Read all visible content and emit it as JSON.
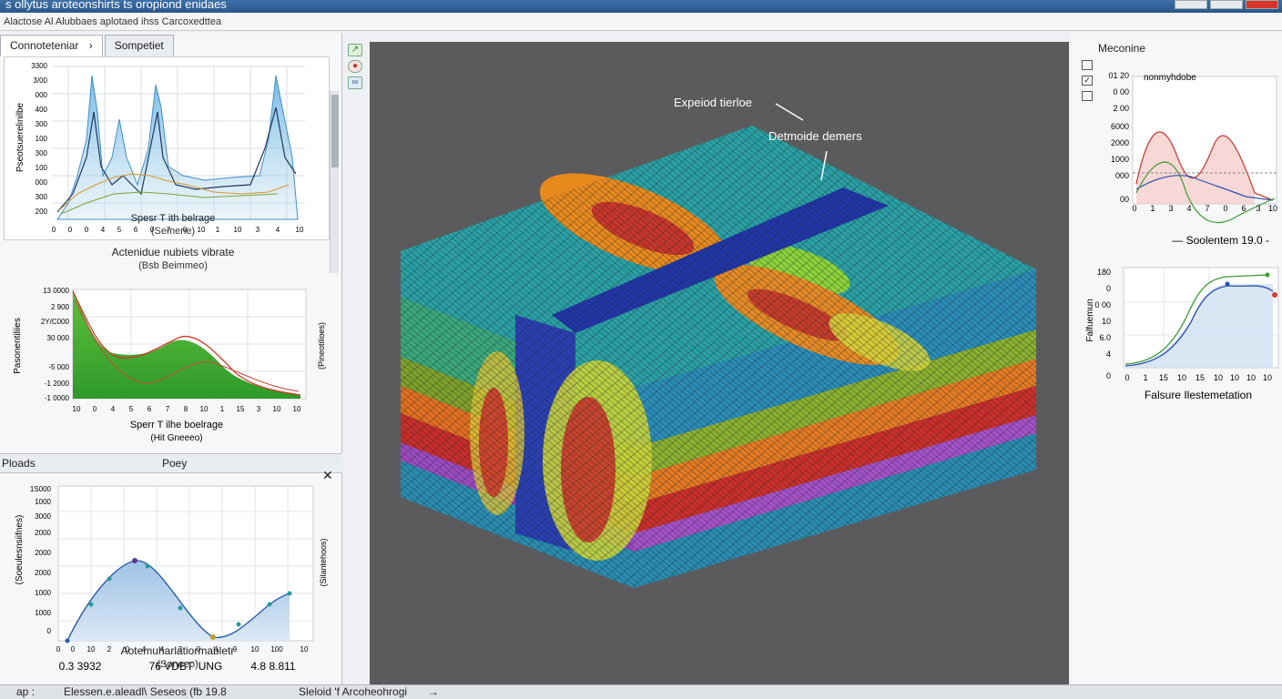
{
  "window": {
    "title": "s ollytus aroteonshirts ts oropiond enidaes",
    "menu_text": "Alactose Al Alubbaes aplotaed ihss Carcoxedttea"
  },
  "left_panel": {
    "tabs": [
      {
        "label": "Connoteteniar",
        "chevron": "›"
      },
      {
        "label": "Sompetiet"
      }
    ],
    "section_header": {
      "left": "Ploads",
      "center": "Poey",
      "close": "✕"
    }
  },
  "charts": {
    "chart1": {
      "ylabel": "Pseotsuerelinilbe",
      "yticks": [
        "3300",
        "3/00",
        "000",
        "400",
        "300",
        "100",
        "300",
        "100",
        "000",
        "300",
        "200"
      ],
      "xticks": [
        "0",
        "0",
        "0",
        "4",
        "5",
        "6",
        "0",
        "7",
        "0",
        "10",
        "1",
        "10",
        "3",
        "4",
        "10"
      ],
      "xlabel": "Spesr T ith belrage",
      "sub": "(Semene)",
      "caption_below": "Actenidue nubiets vibrate",
      "caption_below_sub": "(Bsb Beimmeo)"
    },
    "chart2": {
      "ylabel": "Pasonentiliies",
      "yticks": [
        "13 0000",
        "2 900",
        "2Y/C000",
        "30 000",
        "-5 000",
        "-1 2000",
        "-1 0000"
      ],
      "xticks": [
        "10",
        "0",
        "4",
        "5",
        "6",
        "7",
        "8",
        "10",
        "1",
        "15",
        "3",
        "10",
        "10"
      ],
      "right_label": "(Pineotilioes)",
      "xlabel": "Sperr T ilhe boelrage",
      "sub": "(Hit Gneeeo)"
    },
    "chart3": {
      "ylabel": "(Soeulesnsiifnes)",
      "yticks": [
        "1S000",
        "1000",
        "3000",
        "2000",
        "2000",
        "2000",
        "1000",
        "1000",
        "0"
      ],
      "xticks": [
        "0",
        "0",
        "10",
        "2",
        "0",
        "4",
        "4",
        "3",
        "0",
        "1",
        "9",
        "10",
        "100",
        "10"
      ],
      "right_label": "(Silantehoos)",
      "xlabel_left": "0.3 3932",
      "xlabel_mid": "76 VDBT 'UNG",
      "xlabel_right": "4.8 8.811",
      "caption": "Aotemuharlatiormabletr",
      "caption_sub": "(Soneeo)"
    },
    "chart4": {
      "title": "Meconine",
      "subtitle": "nonmyhdobe",
      "yticks": [
        "01 20",
        "0 00",
        "2 00",
        "6000",
        "2000",
        "1000",
        "000",
        "00"
      ],
      "xticks": [
        "0",
        "1",
        "3",
        "4",
        "7",
        "0",
        "6",
        "3",
        "10"
      ],
      "caption": "— Soolentem 19.0 -"
    },
    "chart5": {
      "ylabel": "Falfuemun",
      "yticks": [
        "180",
        "0",
        "0 00",
        "10",
        "6.0",
        "4",
        "0"
      ],
      "xticks": [
        "0",
        "1",
        "15",
        "10",
        "15",
        "10",
        "10",
        "10",
        "10"
      ],
      "xlabel": "Falsure Ilestemetation"
    }
  },
  "viewport": {
    "label1": "Expeiod tierloe",
    "label2": "Detmoide demers"
  },
  "status_bar": {
    "left": "ap :",
    "mid": "Elessen.e.aleadl\\ Seseos (fb 19.8",
    "right": "Sleloid 'f Arcoheohrogi",
    "arrow": "→"
  },
  "colors": {
    "title_bar": "#2b578a",
    "viewport_bg": "#5b5b5d",
    "blue_band": "#2135a8",
    "top_teal": "#2aa0a5",
    "orange": "#e36f1f",
    "red": "#c92d2a",
    "purple": "#9b4ac0",
    "green": "#6fa72c"
  }
}
